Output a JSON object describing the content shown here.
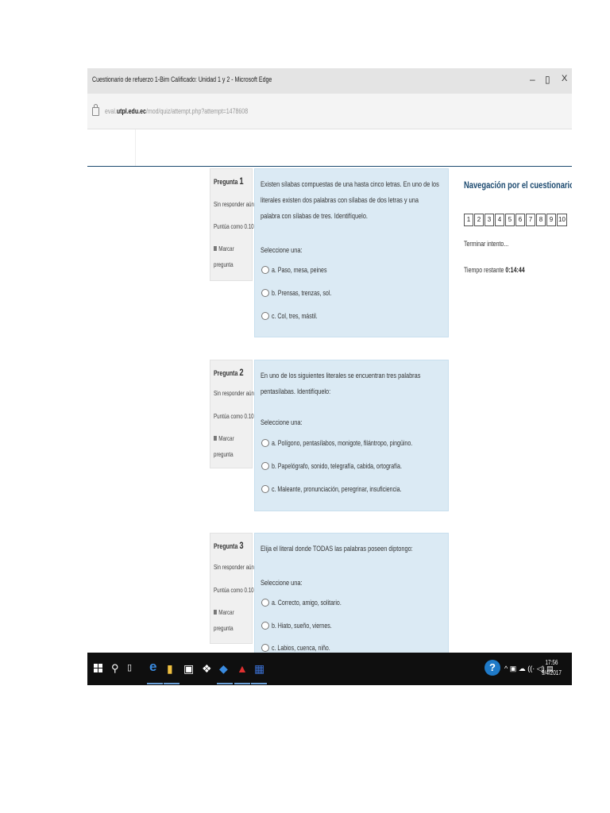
{
  "window": {
    "title": "Cuestionario de refuerzo 1-Bim Calificado: Unidad 1 y 2 - Microsoft Edge",
    "minimize": "–",
    "restore": "▯",
    "close": "X"
  },
  "address": {
    "url_prefix": "eval.",
    "url_domain": "utpl.edu.ec",
    "url_path": "/mod/quiz/attempt.php?attempt=1478608"
  },
  "questions": [
    {
      "label": "Pregunta",
      "number": "1",
      "status": "Sin responder aún",
      "score": "Puntúa como 0.10",
      "flag_line1": "Marcar",
      "flag_line2": "pregunta",
      "text": "Existen sílabas compuestas de una hasta cinco letras. En uno de los literales existen dos palabras con sílabas de dos letras y una palabra con sílabas de tres. Identifíquelo.",
      "select": "Seleccione una:",
      "options": [
        "a. Paso, mesa, peines",
        "b. Prensas, trenzas, sol.",
        "c. Col, tres, mástil."
      ]
    },
    {
      "label": "Pregunta",
      "number": "2",
      "status": "Sin responder aún",
      "score": "Puntúa como 0.10",
      "flag_line1": "Marcar",
      "flag_line2": "pregunta",
      "text": "En uno de los siguientes literales se encuentran tres palabras pentasílabas. Identifíquelo:",
      "select": "Seleccione una:",
      "options": [
        "a. Polígono, pentasílabos, monigote, filántropo, pingüino.",
        "b. Papelógrafo, sonido, telegrafía, cabida, ortografía.",
        "c. Maleante, pronunciación, peregrinar, insuficiencia."
      ]
    },
    {
      "label": "Pregunta",
      "number": "3",
      "status": "Sin responder aún",
      "score": "Puntúa como 0.10",
      "flag_line1": "Marcar",
      "flag_line2": "pregunta",
      "text": "Elija el literal donde TODAS las palabras poseen diptongo:",
      "select": "Seleccione una:",
      "options": [
        "a. Correcto, amigo, solitario.",
        "b. Hiato, sueño, viernes.",
        "c. Labios, cuenca, niño."
      ]
    }
  ],
  "nav": {
    "title": "Navegación por el cuestionario",
    "buttons": [
      "1",
      "2",
      "3",
      "4",
      "5",
      "6",
      "7",
      "8",
      "9",
      "10"
    ],
    "finish": "Terminar intento...",
    "time_label": "Tiempo restante",
    "time_value": "0:14:44"
  },
  "taskbar": {
    "help": "?",
    "tray": "^ ▣ ☁ ((· ◁) ▤",
    "time": "17:56",
    "date": "9/4/2017"
  },
  "colors": {
    "question_bg": "#dbeaf4",
    "info_bg": "#f0f0f0",
    "nav_title": "#1c4a70",
    "taskbar": "#0f0f0f"
  }
}
